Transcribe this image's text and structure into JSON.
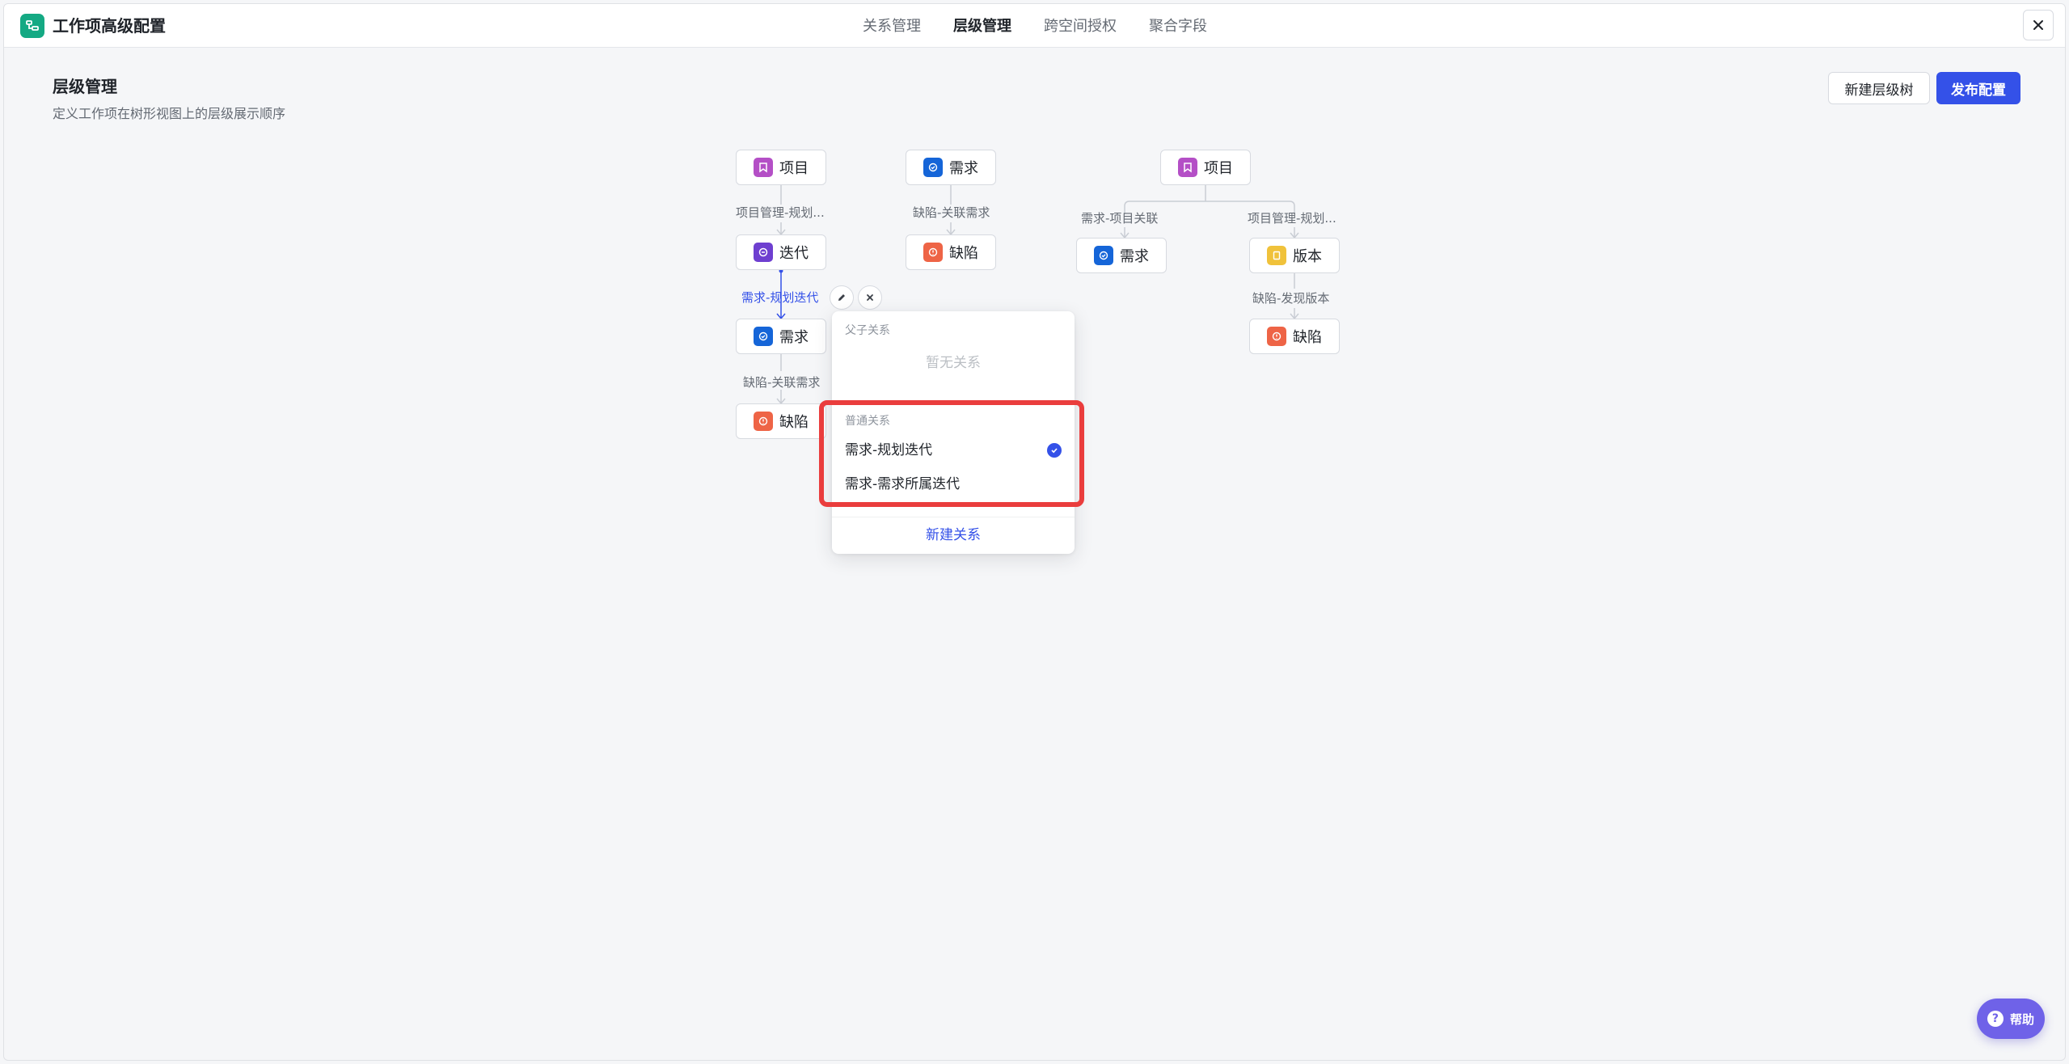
{
  "app": {
    "title": "工作项高级配置"
  },
  "tabs": [
    {
      "label": "关系管理",
      "active": false
    },
    {
      "label": "层级管理",
      "active": true
    },
    {
      "label": "跨空间授权",
      "active": false
    },
    {
      "label": "聚合字段",
      "active": false
    }
  ],
  "page": {
    "title": "层级管理",
    "description": "定义工作项在树形视图上的层级展示顺序",
    "new_tree_label": "新建层级树",
    "publish_label": "发布配置"
  },
  "tree1": {
    "nodes": [
      "项目",
      "迭代",
      "需求",
      "缺陷"
    ],
    "edges": [
      "项目管理-规划...",
      "需求-规划迭代",
      "缺陷-关联需求"
    ]
  },
  "tree2": {
    "nodes": [
      "需求",
      "缺陷"
    ],
    "edges": [
      "缺陷-关联需求"
    ]
  },
  "tree3": {
    "nodes": [
      "项目",
      "需求",
      "版本",
      "缺陷"
    ],
    "edges": [
      "需求-项目关联",
      "项目管理-规划...",
      "缺陷-发现版本"
    ]
  },
  "popover": {
    "parent_section": "父子关系",
    "parent_empty": "暂无关系",
    "normal_section": "普通关系",
    "items": [
      {
        "label": "需求-规划迭代",
        "selected": true
      },
      {
        "label": "需求-需求所属迭代",
        "selected": false
      }
    ],
    "new_relation": "新建关系"
  },
  "help": {
    "label": "帮助"
  },
  "colors": {
    "accent": "#3451e8",
    "project": "#b44fc6",
    "iteration": "#6e3fd0",
    "requirement": "#1565d8",
    "defect": "#ee6446",
    "version": "#f0c23b",
    "highlight": "#ea3d3d"
  },
  "icons": {
    "project": "bookmark-icon",
    "iteration": "cycle-icon",
    "requirement": "check-circle-icon",
    "defect": "alert-circle-icon",
    "version": "document-icon"
  }
}
